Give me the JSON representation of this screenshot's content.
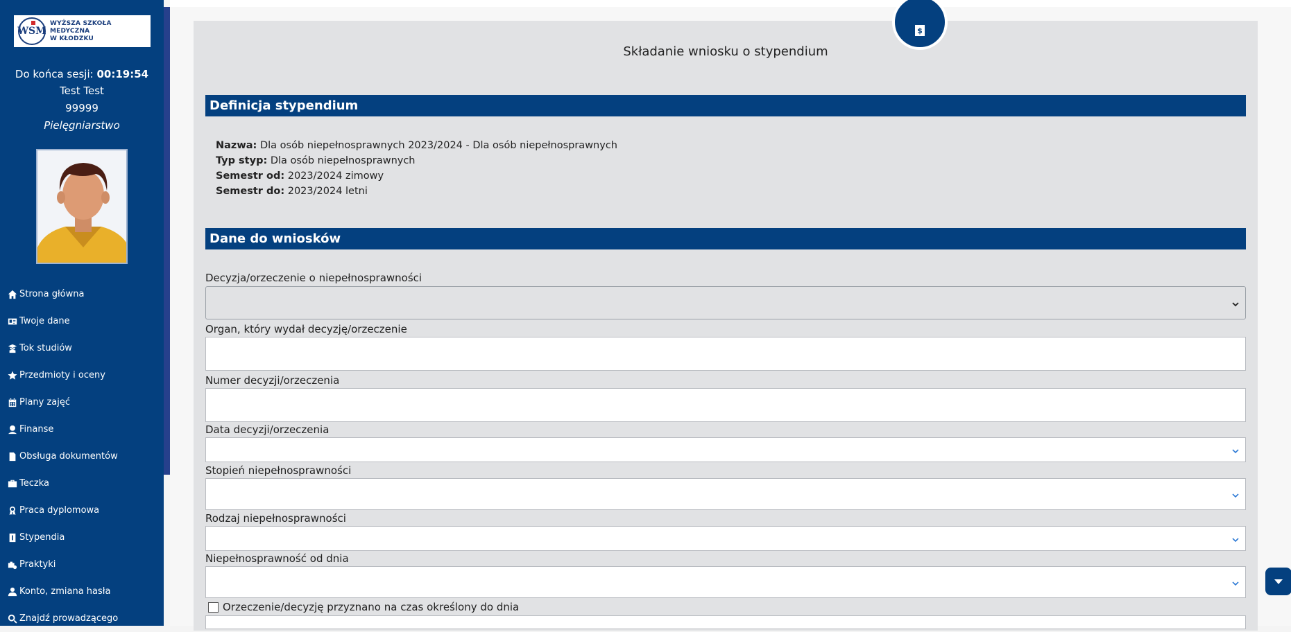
{
  "logo": {
    "emblem": "WSM",
    "line1": "WYŻSZA SZKOŁA MEDYCZNA",
    "line2": "W KŁODZKU"
  },
  "session": {
    "label": "Do końca sesji:",
    "timer": "00:19:54"
  },
  "user": {
    "name": "Test Test",
    "id": "99999",
    "field": "Pielęgniarstwo"
  },
  "nav": {
    "items": [
      {
        "label": "Strona główna",
        "icon": "home-icon"
      },
      {
        "label": "Twoje dane",
        "icon": "id-card-icon"
      },
      {
        "label": "Tok studiów",
        "icon": "graduate-icon"
      },
      {
        "label": "Przedmioty i oceny",
        "icon": "star-icon"
      },
      {
        "label": "Plany zajęć",
        "icon": "calendar-icon"
      },
      {
        "label": "Finanse",
        "icon": "money-user-icon"
      },
      {
        "label": "Obsługa dokumentów",
        "icon": "document-icon"
      },
      {
        "label": "Teczka",
        "icon": "briefcase-icon"
      },
      {
        "label": "Praca dyplomowa",
        "icon": "award-icon"
      },
      {
        "label": "Stypendia",
        "icon": "scholarship-icon"
      },
      {
        "label": "Praktyki",
        "icon": "internship-icon"
      },
      {
        "label": "Konto, zmiana hasła",
        "icon": "user-icon"
      },
      {
        "label": "Znajdź prowadzącego",
        "icon": "search-icon"
      }
    ]
  },
  "main": {
    "page_title": "Składanie wniosku o stypendium",
    "definition": {
      "header": "Definicja stypendium",
      "name_label": "Nazwa:",
      "name_value": "Dla osób niepełnosprawnych 2023/2024 - Dla osób niepełnosprawnych",
      "type_label": "Typ styp:",
      "type_value": "Dla osób niepełnosprawnych",
      "from_label": "Semestr od:",
      "from_value": "2023/2024 zimowy",
      "to_label": "Semestr do:",
      "to_value": "2023/2024 letni"
    },
    "data_section": {
      "header": "Dane do wniosków",
      "fields": {
        "decision": {
          "label": "Decyzja/orzeczenie o niepełnosprawności",
          "value": ""
        },
        "organ": {
          "label": "Organ, który wydał decyzję/orzeczenie",
          "value": ""
        },
        "number": {
          "label": "Numer decyzji/orzeczenia",
          "value": ""
        },
        "date": {
          "label": "Data decyzji/orzeczenia",
          "value": ""
        },
        "degree": {
          "label": "Stopień niepełnosprawności",
          "value": ""
        },
        "kind": {
          "label": "Rodzaj niepełnosprawności",
          "value": ""
        },
        "since": {
          "label": "Niepełnosprawność od dnia",
          "value": ""
        }
      },
      "checkbox_label": "Orzeczenie/decyzję przyznano na czas określony do dnia",
      "checkbox_checked": false
    }
  },
  "colors": {
    "primary": "#04407f",
    "card": "#e1e2e4",
    "accent": "#26408c"
  }
}
